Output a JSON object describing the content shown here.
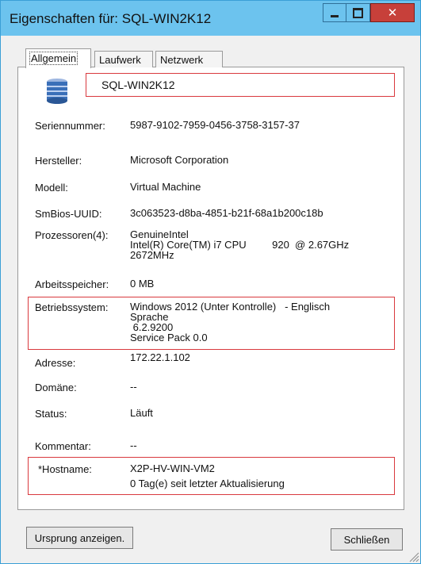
{
  "window": {
    "title": "Eigenschaften für: SQL-WIN2K12"
  },
  "tabs": [
    "Allgemein",
    "Laufwerk",
    "Netzwerk"
  ],
  "active_tab": "Allgemein",
  "computer_name": "SQL-WIN2K12",
  "fields": {
    "serial": {
      "label": "Seriennummer:",
      "value": "5987-9102-7959-0456-3758-3157-37"
    },
    "manufacturer": {
      "label": "Hersteller:",
      "value": "Microsoft Corporation"
    },
    "model": {
      "label": "Modell:",
      "value": "Virtual Machine"
    },
    "smbios": {
      "label": "SmBios-UUID:",
      "value": "3c063523-d8ba-4851-b21f-68a1b200c18b"
    },
    "cpu": {
      "label": "Prozessoren(4):",
      "value": "GenuineIntel\nIntel(R) Core(TM) i7 CPU         920  @ 2.67GHz\n2672MHz"
    },
    "memory": {
      "label": "Arbeitsspeicher:",
      "value": "0 MB"
    },
    "os": {
      "label": "Betriebssystem:",
      "value": "Windows 2012 (Unter Kontrolle)   - Englisch\nSprache\n 6.2.9200\nService Pack 0.0"
    },
    "address": {
      "label": "Adresse:",
      "value": "172.22.1.102"
    },
    "domain": {
      "label": "Domäne:",
      "value": "--"
    },
    "status": {
      "label": "Status:",
      "value": "Läuft"
    },
    "comment": {
      "label": "Kommentar:",
      "value": "--"
    },
    "hostname": {
      "label": "*Hostname:",
      "value": "X2P-HV-WIN-VM2"
    },
    "last_update": {
      "value": "0 Tag(e) seit letzter Aktualisierung"
    }
  },
  "buttons": {
    "origin": "Ursprung anzeigen.",
    "close": "Schließen"
  },
  "colors": {
    "titlebar": "#6cc3ee",
    "close_button": "#c7403a",
    "highlight": "#d9393e"
  }
}
